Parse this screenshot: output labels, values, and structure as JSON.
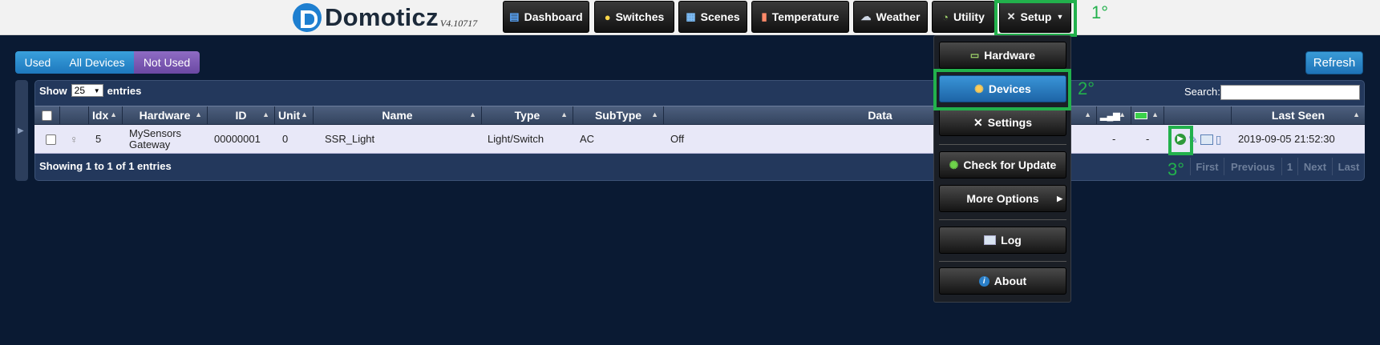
{
  "app": {
    "name": "Domoticz",
    "version": "V4.10717"
  },
  "nav": {
    "dashboard": "Dashboard",
    "switches": "Switches",
    "scenes": "Scenes",
    "temperature": "Temperature",
    "weather": "Weather",
    "utility": "Utility",
    "setup": "Setup"
  },
  "filters": {
    "used": "Used",
    "all": "All Devices",
    "not_used": "Not Used"
  },
  "refresh_label": "Refresh",
  "table_controls": {
    "show": "Show",
    "entries_value": "25",
    "entries": "entries",
    "search": "Search:"
  },
  "columns": {
    "idx": "Idx",
    "hardware": "Hardware",
    "id": "ID",
    "unit": "Unit",
    "name": "Name",
    "type": "Type",
    "subtype": "SubType",
    "data": "Data",
    "last_seen": "Last Seen"
  },
  "rows": [
    {
      "idx": "5",
      "hardware_line1": "MySensors",
      "hardware_line2": "Gateway",
      "id": "00000001",
      "unit": "0",
      "name": "SSR_Light",
      "type": "Light/Switch",
      "subtype": "AC",
      "data": "Off",
      "signal": "-",
      "battery": "-",
      "last_seen": "2019-09-05 21:52:30"
    }
  ],
  "footer": {
    "showing": "Showing 1 to 1 of 1 entries"
  },
  "pagination": {
    "first": "First",
    "previous": "Previous",
    "page": "1",
    "next": "Next",
    "last": "Last"
  },
  "setup_menu": {
    "hardware": "Hardware",
    "devices": "Devices",
    "settings": "Settings",
    "check_update": "Check for Update",
    "more_options": "More Options",
    "log": "Log",
    "about": "About"
  },
  "annotations": {
    "step1": "1°",
    "step2": "2°",
    "step3": "3°"
  },
  "colors": {
    "highlight": "#22b14c",
    "active_blue": "#2a7fc8",
    "not_used_purple": "#7a56b0"
  }
}
